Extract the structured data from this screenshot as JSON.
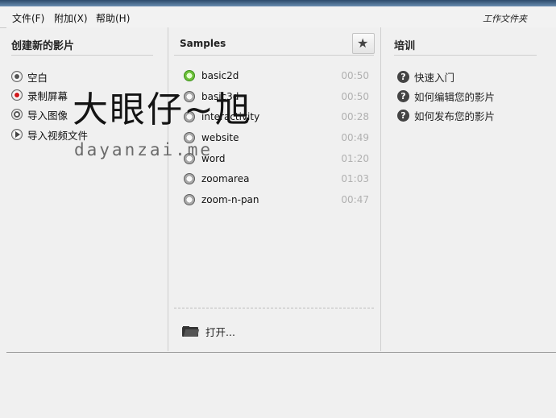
{
  "menubar": {
    "items": [
      "文件(F)",
      "附加(X)",
      "帮助(H)"
    ],
    "workspace": "工作文件夹"
  },
  "create": {
    "title": "创建新的影片",
    "items": [
      {
        "label": "空白",
        "icon": "blank-movie-icon"
      },
      {
        "label": "录制屏幕",
        "icon": "record-icon"
      },
      {
        "label": "导入图像",
        "icon": "import-image-icon"
      },
      {
        "label": "导入视频文件",
        "icon": "import-video-icon"
      }
    ]
  },
  "samples": {
    "title": "Samples",
    "star_icon": "star-icon",
    "items": [
      {
        "name": "basic2d",
        "time": "00:50",
        "active": true
      },
      {
        "name": "basic3d",
        "time": "00:50",
        "active": false
      },
      {
        "name": "interactivity",
        "time": "00:28",
        "active": false
      },
      {
        "name": "website",
        "time": "00:49",
        "active": false
      },
      {
        "name": "word",
        "time": "01:20",
        "active": false
      },
      {
        "name": "zoomarea",
        "time": "01:03",
        "active": false
      },
      {
        "name": "zoom-n-pan",
        "time": "00:47",
        "active": false
      }
    ],
    "open_label": "打开..."
  },
  "training": {
    "title": "培训",
    "items": [
      "快速入门",
      "如何编辑您的影片",
      "如何发布您的影片"
    ]
  },
  "watermark": {
    "cn": "大眼仔~旭",
    "en": "dayanzai.me"
  },
  "colors": {
    "accent_red": "#d0181b",
    "active_green": "#6dc13a",
    "time_gray": "#b0b0b0"
  }
}
